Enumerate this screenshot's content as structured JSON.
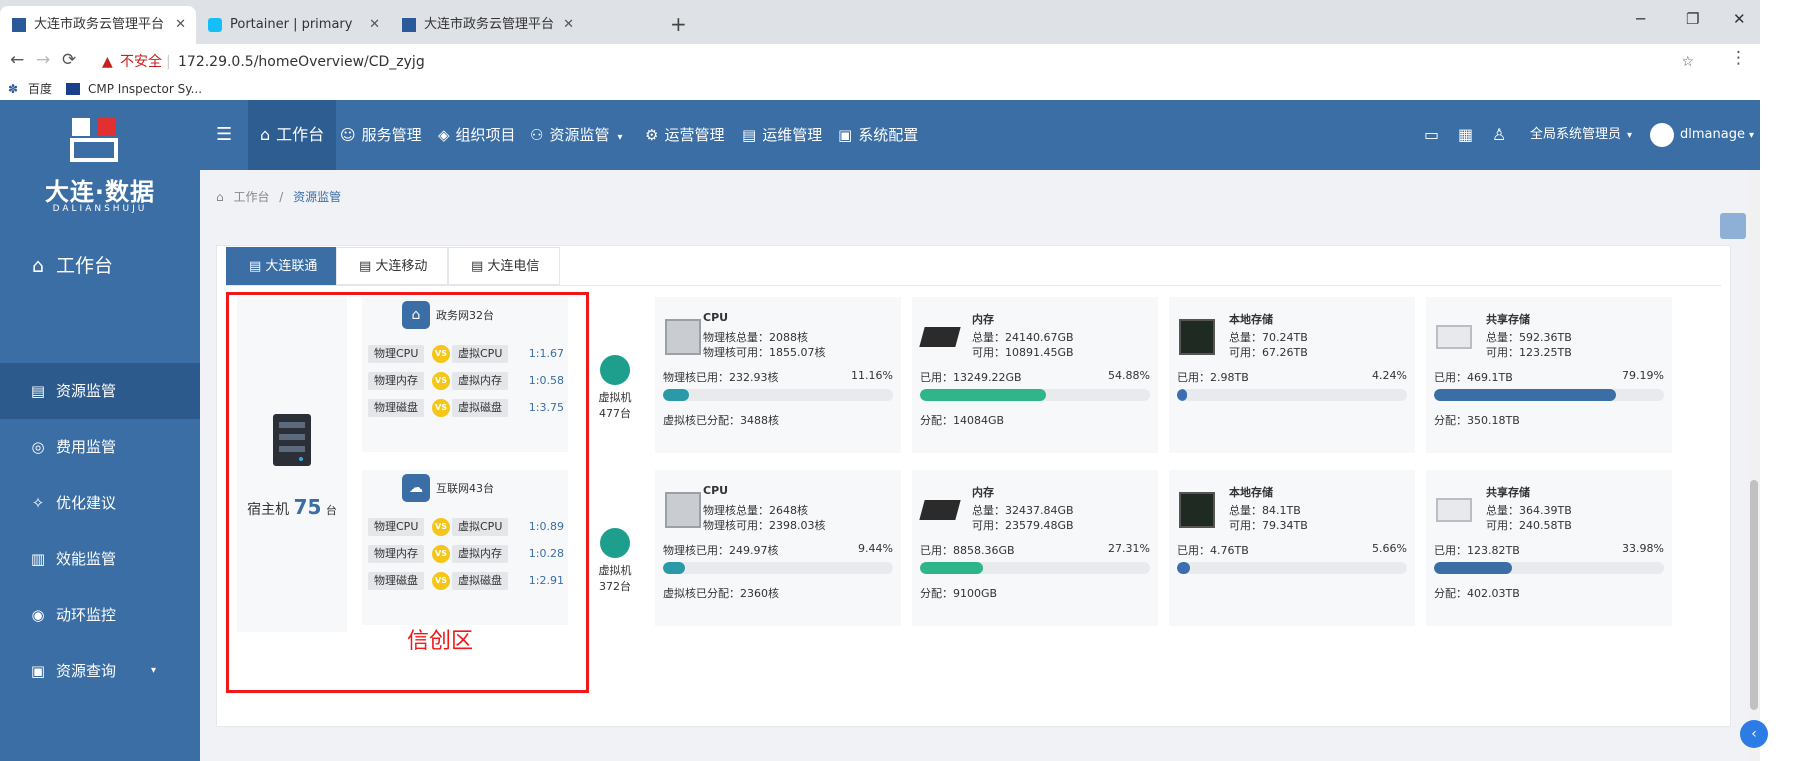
{
  "browser": {
    "tabs": [
      {
        "title": "大连市政务云管理平台",
        "active": true
      },
      {
        "title": "Portainer | primary",
        "active": false
      },
      {
        "title": "大连市政务云管理平台",
        "active": false
      }
    ],
    "security_label": "不安全",
    "url": "172.29.0.5/homeOverview/CD_zyjg",
    "bookmarks": [
      "百度",
      "CMP Inspector Sy..."
    ]
  },
  "logo": {
    "main": "大连·数据",
    "sub": "DALIANSHUJU"
  },
  "topnav": {
    "items": [
      "工作台",
      "服务管理",
      "组织项目",
      "资源监管",
      "运营管理",
      "运维管理",
      "系统配置"
    ],
    "role": "全局系统管理员",
    "user": "dlmanage"
  },
  "sidebar": {
    "header": "工作台",
    "items": [
      "资源监管",
      "费用监管",
      "优化建议",
      "效能监管",
      "动环监控",
      "资源查询"
    ]
  },
  "breadcrumb": {
    "home": "工作台",
    "sep": "/",
    "current": "资源监管"
  },
  "tabs": [
    "大连联通",
    "大连移动",
    "大连电信"
  ],
  "host": {
    "label": "宿主机",
    "count": "75",
    "unit": "台"
  },
  "zone_label": "信创区",
  "networks": [
    {
      "title": "政务网32台",
      "ratios": [
        {
          "left": "物理CPU",
          "vs": "VS",
          "right": "虚拟CPU",
          "value": "1:1.67"
        },
        {
          "left": "物理内存",
          "vs": "VS",
          "right": "虚拟内存",
          "value": "1:0.58"
        },
        {
          "left": "物理磁盘",
          "vs": "VS",
          "right": "虚拟磁盘",
          "value": "1:3.75"
        }
      ],
      "vm": {
        "label": "虚拟机",
        "count": "477台"
      },
      "resources": {
        "cpu": {
          "title": "CPU",
          "line1": "物理核总量：2088核",
          "line2": "物理核可用：1855.07核",
          "used": "物理核已用：232.93核",
          "pct": "11.16%",
          "pct_value": 11.16,
          "bottom": "虚拟核已分配：3488核"
        },
        "mem": {
          "title": "内存",
          "line1": "总量：24140.67GB",
          "line2": "可用：10891.45GB",
          "used": "已用：13249.22GB",
          "pct": "54.88%",
          "pct_value": 54.88,
          "bottom": "分配：14084GB"
        },
        "local": {
          "title": "本地存储",
          "line1": "总量：70.24TB",
          "line2": "可用：67.26TB",
          "used": "已用：2.98TB",
          "pct": "4.24%",
          "pct_value": 4.24,
          "bottom": ""
        },
        "shared": {
          "title": "共享存储",
          "line1": "总量：592.36TB",
          "line2": "可用：123.25TB",
          "used": "已用：469.1TB",
          "pct": "79.19%",
          "pct_value": 79.19,
          "bottom": "分配：350.18TB"
        }
      }
    },
    {
      "title": "互联网43台",
      "ratios": [
        {
          "left": "物理CPU",
          "vs": "VS",
          "right": "虚拟CPU",
          "value": "1:0.89"
        },
        {
          "left": "物理内存",
          "vs": "VS",
          "right": "虚拟内存",
          "value": "1:0.28"
        },
        {
          "left": "物理磁盘",
          "vs": "VS",
          "right": "虚拟磁盘",
          "value": "1:2.91"
        }
      ],
      "vm": {
        "label": "虚拟机",
        "count": "372台"
      },
      "resources": {
        "cpu": {
          "title": "CPU",
          "line1": "物理核总量：2648核",
          "line2": "物理核可用：2398.03核",
          "used": "物理核已用：249.97核",
          "pct": "9.44%",
          "pct_value": 9.44,
          "bottom": "虚拟核已分配：2360核"
        },
        "mem": {
          "title": "内存",
          "line1": "总量：32437.84GB",
          "line2": "可用：23579.48GB",
          "used": "已用：8858.36GB",
          "pct": "27.31%",
          "pct_value": 27.31,
          "bottom": "分配：9100GB"
        },
        "local": {
          "title": "本地存储",
          "line1": "总量：84.1TB",
          "line2": "可用：79.34TB",
          "used": "已用：4.76TB",
          "pct": "5.66%",
          "pct_value": 5.66,
          "bottom": ""
        },
        "shared": {
          "title": "共享存储",
          "line1": "总量：364.39TB",
          "line2": "可用：240.58TB",
          "used": "已用：123.82TB",
          "pct": "33.98%",
          "pct_value": 33.98,
          "bottom": "分配：402.03TB"
        }
      }
    }
  ],
  "colors": {
    "primary": "#3a6ea5",
    "cpu_bar": "#2a9aa8",
    "mem_bar": "#2fb58a",
    "local_bar": "#3b6db0",
    "shared_bar": "#3a6ea5",
    "highlight": "#f01818"
  }
}
